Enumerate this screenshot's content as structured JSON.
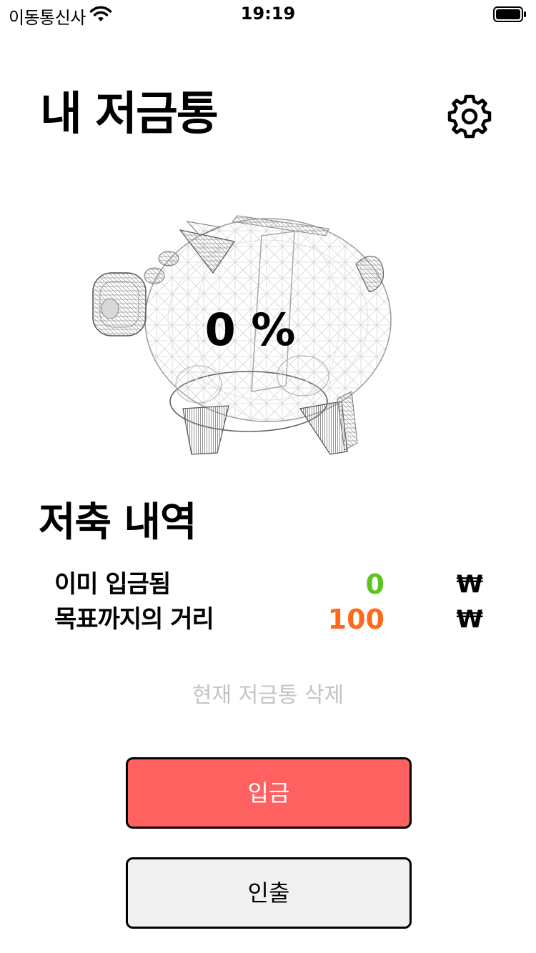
{
  "status_bar": {
    "carrier": "이동통신사",
    "time": "19:19"
  },
  "header": {
    "title": "내 저금통",
    "settings_icon": "gear-icon"
  },
  "piggy_bank": {
    "image": "piggy-bank-wireframe",
    "progress_label": "0 %",
    "progress": 0
  },
  "history": {
    "title": "저축 내역",
    "rows": [
      {
        "label": "이미 입금됨",
        "amount": "0",
        "currency": "₩",
        "color": "#5cc41e"
      },
      {
        "label": "목표까지의 거리",
        "amount": "100",
        "currency": "₩",
        "color": "#ff6a1a"
      }
    ]
  },
  "actions": {
    "delete_label": "현재 저금통 삭제",
    "deposit_label": "입금",
    "withdraw_label": "인출"
  },
  "colors": {
    "deposit_bg": "#ff6161",
    "withdraw_bg": "#f0f0f0",
    "muted_text": "#c4c4c6"
  }
}
